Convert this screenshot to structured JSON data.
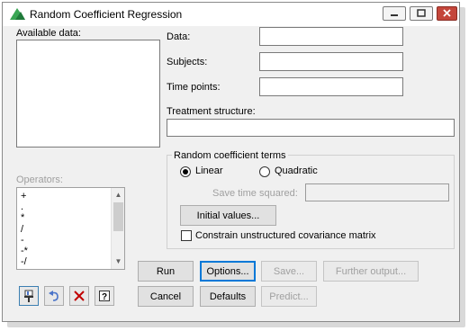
{
  "window": {
    "title": "Random Coefficient Regression"
  },
  "available_data": {
    "label": "Available data:"
  },
  "fields": {
    "data_label": "Data:",
    "subjects_label": "Subjects:",
    "time_points_label": "Time points:",
    "treatment_structure_label": "Treatment structure:",
    "data_value": "",
    "subjects_value": "",
    "time_points_value": "",
    "treatment_structure_value": ""
  },
  "operators": {
    "label": "Operators:",
    "items": [
      "+",
      ".",
      "*",
      "/",
      "-",
      "-*",
      "-/"
    ]
  },
  "random_terms": {
    "group_label": "Random coefficient terms",
    "linear_label": "Linear",
    "quadratic_label": "Quadratic",
    "selected": "Linear",
    "save_time_squared_label": "Save time squared:",
    "save_time_squared_value": "",
    "initial_values_button": "Initial values...",
    "constrain_label": "Constrain unstructured covariance matrix",
    "constrain_checked": false
  },
  "buttons": {
    "run": "Run",
    "options": "Options...",
    "save": "Save...",
    "further_output": "Further output...",
    "cancel": "Cancel",
    "defaults": "Defaults",
    "predict": "Predict..."
  },
  "toolbar_icons": [
    "pin-icon",
    "undo-icon",
    "clear-icon",
    "help-icon"
  ],
  "colors": {
    "focus_border": "#0078d7",
    "close_button": "#c4463b",
    "disabled_text": "#a0a0a0",
    "undo_icon": "#4a74c9",
    "clear_icon": "#c00000"
  }
}
